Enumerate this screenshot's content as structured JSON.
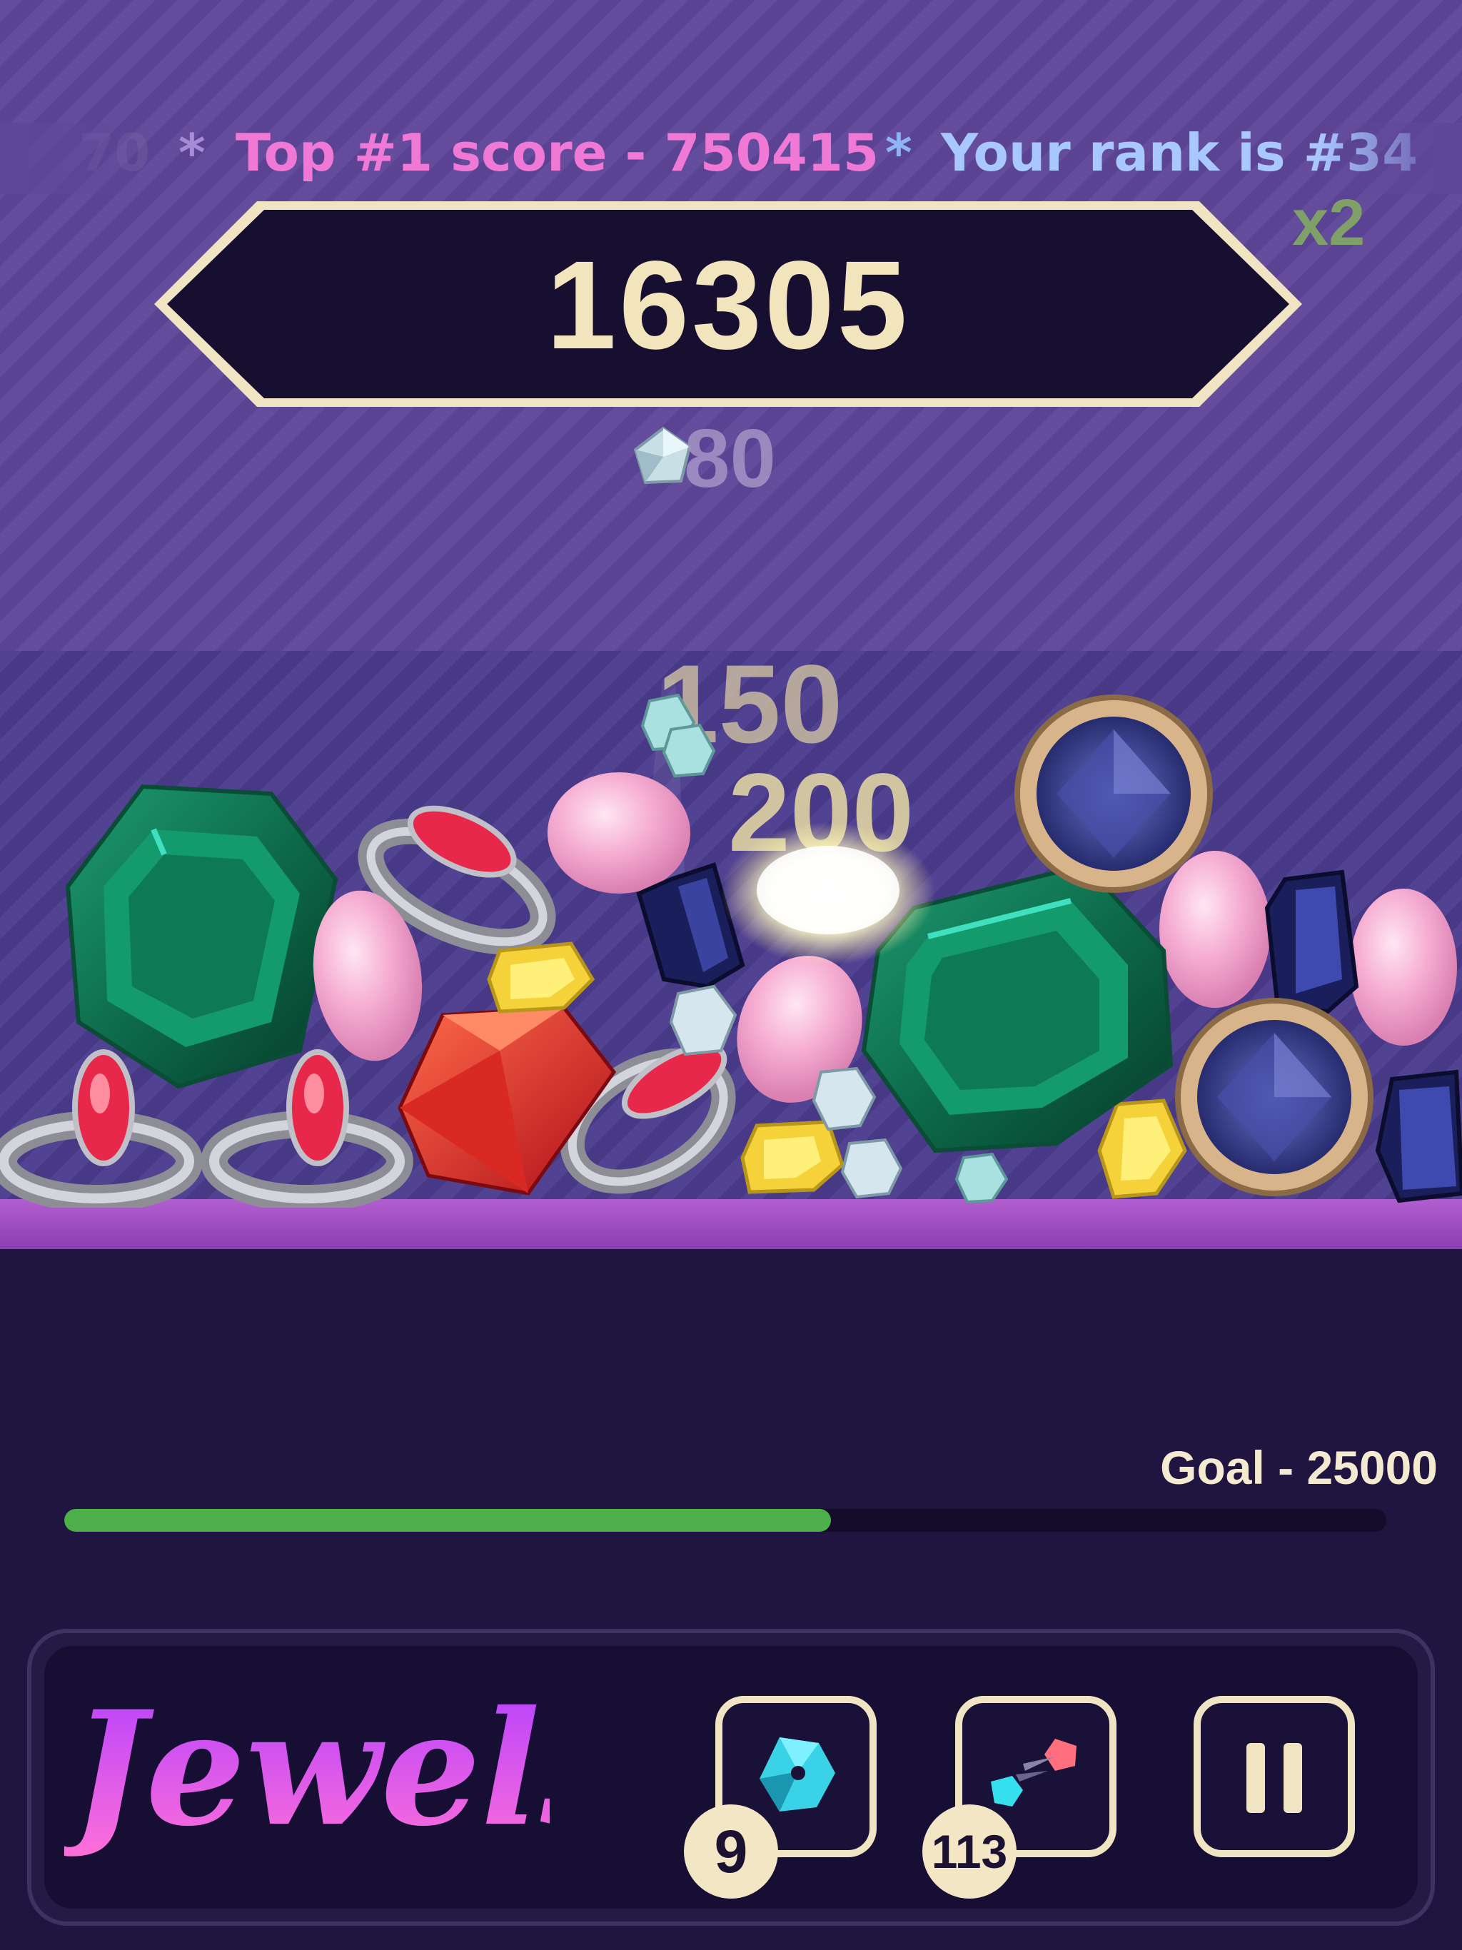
{
  "ticker": {
    "faded_text": "70",
    "star1": "*",
    "top_score": "Top #1 score - 750415",
    "star2": "*",
    "rank": "Your rank is #34"
  },
  "multiplier": "x2",
  "score": "16305",
  "popups": {
    "small": "80",
    "mid": "150",
    "big": "200"
  },
  "goal": {
    "label": "Goal - 25000",
    "progress": 0.58
  },
  "footer": {
    "logo_text": "Jewels",
    "bomb_count": "9",
    "swap_count": "113"
  },
  "colors": {
    "accent_gold": "#f2e4bd",
    "progress_green": "#4caf4a",
    "top_score_pink": "#f079d6",
    "rank_blue": "#a8c8ff"
  }
}
